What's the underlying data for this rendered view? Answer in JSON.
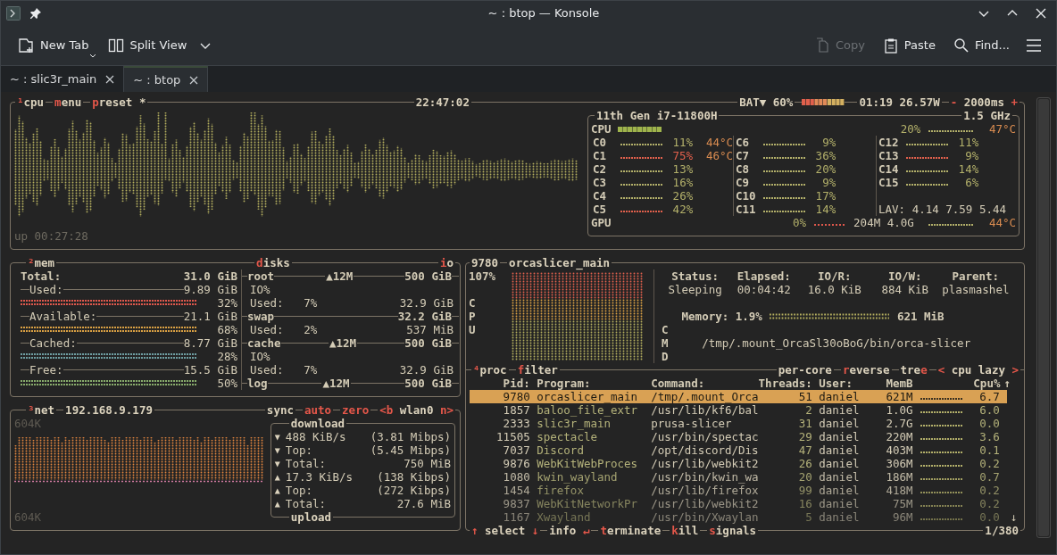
{
  "window": {
    "title": "~ : btop — Konsole"
  },
  "toolbar": {
    "left": [
      {
        "label": "New Tab",
        "kind": "new-tab"
      },
      {
        "label": "Split View",
        "kind": "split"
      }
    ],
    "right": [
      {
        "label": "Copy",
        "kind": "copy",
        "disabled": true
      },
      {
        "label": "Paste",
        "kind": "paste",
        "disabled": false
      },
      {
        "label": "Find...",
        "kind": "find",
        "disabled": false
      }
    ]
  },
  "tabs": [
    {
      "label": "~ : slic3r_main",
      "selected": false
    },
    {
      "label": "~ : btop",
      "selected": true
    }
  ],
  "cpu": {
    "header": [
      {
        "parts": [
          {
            "text": "¹",
            "hotkey": true
          },
          {
            "text": "cpu",
            "hotkey": false
          }
        ]
      },
      {
        "parts": [
          {
            "text": "m",
            "hotkey": true
          },
          {
            "text": "enu",
            "hotkey": false
          }
        ]
      },
      {
        "parts": [
          {
            "text": "p",
            "hotkey": true
          },
          {
            "text": "reset *",
            "hotkey": false
          }
        ]
      }
    ],
    "clock": "22:47:02",
    "battery": {
      "label": "BAT▼",
      "percent": "60%"
    },
    "power": "01:19 26.57W",
    "rate": {
      "parts": [
        {
          "text": "-",
          "hotkey": true
        },
        {
          "text": " 2000ms ",
          "hotkey": false
        },
        {
          "text": "+",
          "hotkey": true
        }
      ]
    },
    "uptime": "up 00:27:28",
    "model": "11th Gen i7-11800H",
    "freq": "1.5 GHz",
    "total": {
      "label": "CPU",
      "usage": "20%",
      "temp": "47°C"
    },
    "cores": [
      {
        "name": "C0",
        "usage": "11%",
        "temp": "44°C",
        "hot": false,
        "color": "#b3b06a"
      },
      {
        "name": "C1",
        "usage": "75%",
        "temp": "46°C",
        "hot": true,
        "color": "#e2604c"
      },
      {
        "name": "C2",
        "usage": "13%",
        "hot": false,
        "color": "#b3b06a"
      },
      {
        "name": "C3",
        "usage": "16%",
        "hot": false,
        "color": "#b3b06a"
      },
      {
        "name": "C4",
        "usage": "26%",
        "hot": false,
        "color": "#b3b06a"
      },
      {
        "name": "C5",
        "usage": "42%",
        "hot": false,
        "color": "#e2604c"
      },
      {
        "name": "C6",
        "usage": "9%",
        "hot": false,
        "color": "#b3b06a"
      },
      {
        "name": "C7",
        "usage": "36%",
        "hot": false,
        "color": "#b3b06a"
      },
      {
        "name": "C8",
        "usage": "20%",
        "hot": false,
        "color": "#b3b06a"
      },
      {
        "name": "C9",
        "usage": "9%",
        "hot": false,
        "color": "#b3b06a"
      },
      {
        "name": "C10",
        "usage": "17%",
        "hot": false,
        "color": "#b3b06a"
      },
      {
        "name": "C11",
        "usage": "14%",
        "hot": false,
        "color": "#b3b06a"
      },
      {
        "name": "C12",
        "usage": "11%",
        "hot": false,
        "color": "#b3b06a"
      },
      {
        "name": "C13",
        "usage": "9%",
        "hot": false,
        "color": "#e2604c"
      },
      {
        "name": "C14",
        "usage": "14%",
        "hot": false,
        "color": "#b3b06a"
      },
      {
        "name": "C15",
        "usage": "6%",
        "hot": false,
        "color": "#b3b06a"
      }
    ],
    "load": {
      "label": "LAV:",
      "values": [
        "4.14",
        "7.59",
        "5.44"
      ]
    },
    "gpu": {
      "label": "GPU",
      "usage": "0%",
      "mem": "204M 4.0G",
      "temp": "44°C"
    }
  },
  "mem": {
    "header": {
      "parts": [
        {
          "text": "²",
          "hotkey": true
        },
        {
          "text": "mem",
          "hotkey": false
        }
      ]
    },
    "disks_header": {
      "parts": [
        {
          "text": "d",
          "hotkey": true
        },
        {
          "text": "isks",
          "hotkey": false
        }
      ]
    },
    "io_header": {
      "parts": [
        {
          "text": "i",
          "hotkey": true
        },
        {
          "text": "o",
          "hotkey": false
        }
      ]
    },
    "rows": [
      {
        "kind": "total",
        "label": "Total:",
        "value": "31.0 GiB"
      },
      {
        "kind": "stat",
        "label": "Used:",
        "value": "9.89 GiB",
        "percent": "32%",
        "color": "#e0584c"
      },
      {
        "kind": "stat",
        "label": "Available:",
        "value": "21.1 GiB",
        "percent": "68%",
        "color": "#d9a043"
      },
      {
        "kind": "stat",
        "label": "Cached:",
        "value": "8.77 GiB",
        "percent": "28%",
        "color": "#6f9fa3"
      },
      {
        "kind": "stat",
        "label": "Free:",
        "value": "15.5 GiB",
        "percent": "50%",
        "color": "#89ad6c"
      }
    ],
    "disks": [
      {
        "name": "root",
        "io": "▲12M",
        "size": "500 GiB",
        "lines": [
          {
            "label": "IO%"
          },
          {
            "label": "Used:",
            "percent": "7%",
            "value": "32.9 GiB"
          }
        ]
      },
      {
        "name": "swap",
        "size": "32.2 GiB",
        "lines": [
          {
            "label": "Used:",
            "percent": "2%",
            "value": "537 MiB"
          }
        ]
      },
      {
        "name": "cache",
        "io": "▲12M",
        "size": "500 GiB",
        "lines": [
          {
            "label": "IO%"
          },
          {
            "label": "Used:",
            "percent": "7%",
            "value": "32.9 GiB"
          }
        ]
      },
      {
        "name": "log",
        "io": "▲12M",
        "size": "500 GiB"
      }
    ]
  },
  "net": {
    "header": {
      "parts": [
        {
          "text": "³",
          "hotkey": true
        },
        {
          "text": "net",
          "hotkey": false
        }
      ]
    },
    "address": "192.168.9.179",
    "options": [
      {
        "parts": [
          {
            "text": "sync",
            "hotkey": false
          }
        ]
      },
      {
        "parts": [
          {
            "text": "auto",
            "hotkey": true
          }
        ]
      },
      {
        "parts": [
          {
            "text": "zero",
            "hotkey": true
          }
        ]
      },
      {
        "parts": [
          {
            "text": "<b",
            "hotkey": true
          },
          {
            "text": " wlan0 ",
            "hotkey": false
          },
          {
            "text": "n>",
            "hotkey": true
          }
        ]
      }
    ],
    "scale_top": "604K",
    "scale_bottom": "604K",
    "download_title": "download",
    "upload_title": "upload",
    "stats": [
      {
        "arrow": "▼",
        "label": "488 KiB/s",
        "value": "(3.81 Mibps)"
      },
      {
        "arrow": "▼",
        "label": "Top:",
        "value": "(5.45 Mibps)"
      },
      {
        "arrow": "▼",
        "label": "Total:",
        "value": "750 MiB"
      },
      {
        "arrow": "▲",
        "label": "17.3 KiB/s",
        "value": "(138 Kibps)"
      },
      {
        "arrow": "▲",
        "label": "Top:",
        "value": "(272 Kibps)"
      },
      {
        "arrow": "▲",
        "label": "Total:",
        "value": "27.6 MiB"
      }
    ]
  },
  "proc": {
    "pid": "9780",
    "name": "orcaslicer_main",
    "cpu": "107%",
    "cpu_label": "CPU",
    "stats": [
      {
        "label": "Status:",
        "value": "Sleeping"
      },
      {
        "label": "Elapsed:",
        "value": "00:04:42"
      },
      {
        "label": "IO/R:",
        "value": "16.0 KiB"
      },
      {
        "label": "IO/W:",
        "value": "884 KiB"
      },
      {
        "label": "Parent:",
        "value": "plasmashel"
      }
    ],
    "memory": {
      "label": "Memory: 1.9%",
      "value": "621 MiB"
    },
    "cmd_label": "CMD",
    "command": "/tmp/.mount_OrcaSl30oBoG/bin/orca-slicer",
    "list_left": [
      {
        "parts": [
          {
            "text": "⁴",
            "hotkey": true
          },
          {
            "text": "proc",
            "hotkey": false
          }
        ]
      },
      {
        "parts": [
          {
            "text": "f",
            "hotkey": true
          },
          {
            "text": "ilter",
            "hotkey": false
          }
        ]
      }
    ],
    "list_right": [
      {
        "parts": [
          {
            "text": "per-core",
            "hotkey": false
          }
        ]
      },
      {
        "parts": [
          {
            "text": "r",
            "hotkey": true
          },
          {
            "text": "everse",
            "hotkey": false
          }
        ]
      },
      {
        "parts": [
          {
            "text": "tre",
            "hotkey": false
          },
          {
            "text": "e",
            "hotkey": true
          }
        ]
      },
      {
        "parts": [
          {
            "text": "<",
            "hotkey": true
          },
          {
            "text": " cpu lazy ",
            "hotkey": false
          },
          {
            "text": ">",
            "hotkey": true
          }
        ]
      }
    ],
    "columns": [
      "Pid:",
      "Program:",
      "Command:",
      "Threads:",
      "User:",
      "MemB",
      "Cpu%"
    ],
    "sort_arrow": "↑",
    "end_arrow": "↓",
    "rows": [
      {
        "pid": "9780",
        "program": "orcaslicer_main",
        "command": "/tmp/.mount_Orca",
        "threads": "51",
        "user": "daniel",
        "mem": "621M",
        "cpu": "6.7",
        "selected": true
      },
      {
        "pid": "1857",
        "program": "baloo_file_extr",
        "command": "/usr/lib/kf6/bal",
        "threads": "2",
        "user": "daniel",
        "mem": "1.0G",
        "cpu": "6.0",
        "selected": false
      },
      {
        "pid": "2333",
        "program": "slic3r_main",
        "command": "prusa-slicer",
        "threads": "31",
        "user": "daniel",
        "mem": "2.7G",
        "cpu": "0.0",
        "selected": false
      },
      {
        "pid": "11505",
        "program": "spectacle",
        "command": "/usr/bin/spectac",
        "threads": "29",
        "user": "daniel",
        "mem": "220M",
        "cpu": "3.6",
        "selected": false
      },
      {
        "pid": "7037",
        "program": "Discord",
        "command": "/opt/discord/Dis",
        "threads": "47",
        "user": "daniel",
        "mem": "403M",
        "cpu": "0.1",
        "selected": false
      },
      {
        "pid": "9876",
        "program": "WebKitWebProces",
        "command": "/usr/lib/webkit2",
        "threads": "26",
        "user": "daniel",
        "mem": "306M",
        "cpu": "0.2",
        "selected": false
      },
      {
        "pid": "1080",
        "program": "kwin_wayland",
        "command": "/usr/bin/kwin_wa",
        "threads": "20",
        "user": "daniel",
        "mem": "186M",
        "cpu": "0.7",
        "selected": false
      },
      {
        "pid": "1454",
        "program": "firefox",
        "command": "/usr/lib/firefox",
        "threads": "99",
        "user": "daniel",
        "mem": "418M",
        "cpu": "0.2",
        "selected": false
      },
      {
        "pid": "9837",
        "program": "WebKitNetworkPr",
        "command": "/usr/lib/webkit2",
        "threads": "16",
        "user": "daniel",
        "mem": "75M",
        "cpu": "0.2",
        "selected": false
      },
      {
        "pid": "1167",
        "program": "Xwayland",
        "command": "/usr/bin/Xwaylan",
        "threads": "5",
        "user": "daniel",
        "mem": "96M",
        "cpu": "0.0",
        "selected": false
      }
    ],
    "footer": [
      {
        "parts": [
          {
            "text": "↑",
            "hotkey": true
          },
          {
            "text": " select ",
            "hotkey": false
          },
          {
            "text": "↓",
            "hotkey": true
          }
        ]
      },
      {
        "parts": [
          {
            "text": "info ",
            "hotkey": false
          },
          {
            "text": "↵",
            "hotkey": true
          }
        ]
      },
      {
        "parts": [
          {
            "text": "t",
            "hotkey": true
          },
          {
            "text": "erminate",
            "hotkey": false
          }
        ]
      },
      {
        "parts": [
          {
            "text": "k",
            "hotkey": true
          },
          {
            "text": "ill",
            "hotkey": false
          }
        ]
      },
      {
        "parts": [
          {
            "text": "s",
            "hotkey": true
          },
          {
            "text": "ignals",
            "hotkey": false
          }
        ]
      }
    ],
    "count": "1/380"
  }
}
